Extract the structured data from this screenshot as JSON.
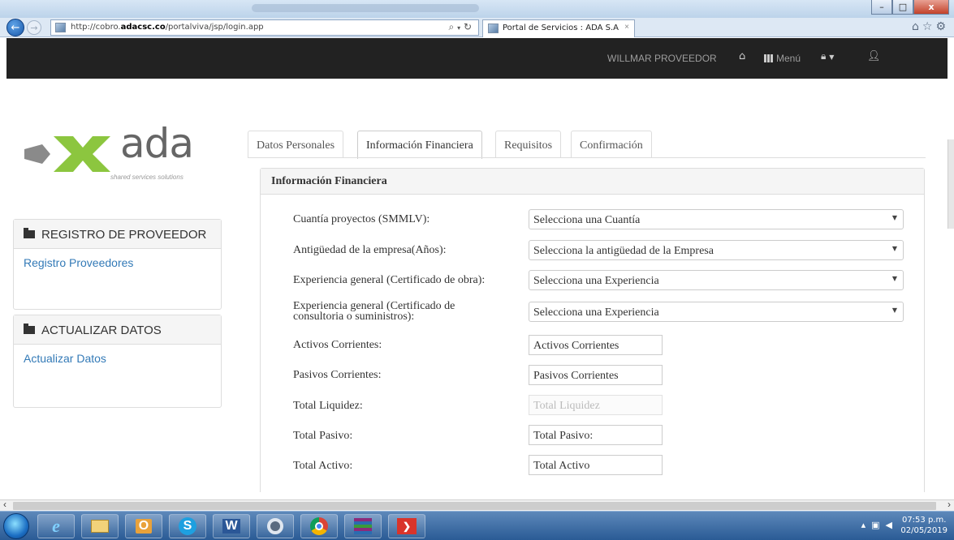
{
  "browser": {
    "url_prefix": "http://cobro.",
    "url_domain": "adacsc.co",
    "url_path": "/portalviva/jsp/login.app",
    "tab_title": "Portal de Servicios : ADA S.A",
    "tab_close": "×",
    "search_icon": "search-icon",
    "refresh_icon": "refresh-icon",
    "win_min": "–",
    "win_max": "□",
    "win_close": "x"
  },
  "topbar": {
    "user_name": "WILLMAR PROVEEDOR",
    "menu_label": "Menú",
    "background": "#222222",
    "text_color": "#9d9d9d"
  },
  "logo": {
    "text": "ada",
    "tagline": "shared services solutions",
    "colors": {
      "grey": "#8a8a8a",
      "green": "#8cc63f"
    }
  },
  "sidebar": {
    "panels": [
      {
        "title": "REGISTRO DE PROVEEDOR",
        "link": "Registro Proveedores"
      },
      {
        "title": "ACTUALIZAR DATOS",
        "link": "Actualizar Datos"
      }
    ],
    "link_color": "#337ab7"
  },
  "tabs": [
    {
      "label": "Datos Personales",
      "active": false
    },
    {
      "label": "Información Financiera",
      "active": true
    },
    {
      "label": "Requisitos",
      "active": false
    },
    {
      "label": "Confirmación",
      "active": false
    }
  ],
  "form": {
    "title": "Información Financiera",
    "selects": [
      {
        "label": "Cuantía proyectos (SMMLV):",
        "value": "Selecciona una Cuantía"
      },
      {
        "label": "Antigüedad de la empresa(Años):",
        "value": "Selecciona la antigüedad de la Empresa"
      },
      {
        "label": "Experiencia general (Certificado de obra):",
        "value": "Selecciona una Experiencia"
      },
      {
        "label_line1": "Experiencia general (Certificado de",
        "label_line2": "consultoria o suministros):",
        "value": "Selecciona una Experiencia"
      }
    ],
    "inputs": [
      {
        "label": "Activos Corrientes:",
        "placeholder": "Activos Corrientes",
        "disabled": false
      },
      {
        "label": "Pasivos Corrientes:",
        "placeholder": "Pasivos Corrientes",
        "disabled": false
      },
      {
        "label": "Total Liquidez:",
        "placeholder": "Total Liquidez",
        "disabled": true
      },
      {
        "label": "Total Pasivo:",
        "placeholder": "Total Pasivo:",
        "disabled": false
      },
      {
        "label": "Total Activo:",
        "placeholder": "Total Activo",
        "disabled": false
      }
    ]
  },
  "taskbar": {
    "time": "07:53 p.m.",
    "date": "02/05/2019",
    "apps": [
      "internet-explorer",
      "file-explorer",
      "outlook",
      "skype",
      "word",
      "settings",
      "chrome",
      "winrar",
      "app-red"
    ],
    "app_s_label": "S",
    "app_w_label": "W",
    "app_o_label": "O"
  }
}
